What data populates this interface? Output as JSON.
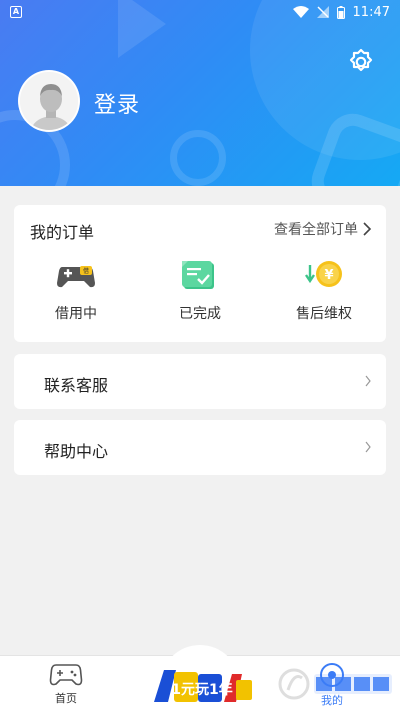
{
  "status_bar": {
    "time": "11:47",
    "app_icon_letter": "A"
  },
  "header": {
    "login_label": "登录",
    "gradient_start": "#4a7bf2",
    "gradient_end": "#15a9f4"
  },
  "orders": {
    "title": "我的订单",
    "view_all_label": "查看全部订单",
    "items": [
      {
        "label": "借用中",
        "icon": "gamepad-icon"
      },
      {
        "label": "已完成",
        "icon": "completed-icon"
      },
      {
        "label": "售后维权",
        "icon": "yuan-refund-icon"
      }
    ]
  },
  "menu": {
    "contact_label": "联系客服",
    "help_label": "帮助中心"
  },
  "bottom_nav": {
    "home_label": "首页",
    "mine_label": "我的",
    "center_logo_text": "1元玩1年",
    "accent": "#3b7cf6"
  }
}
